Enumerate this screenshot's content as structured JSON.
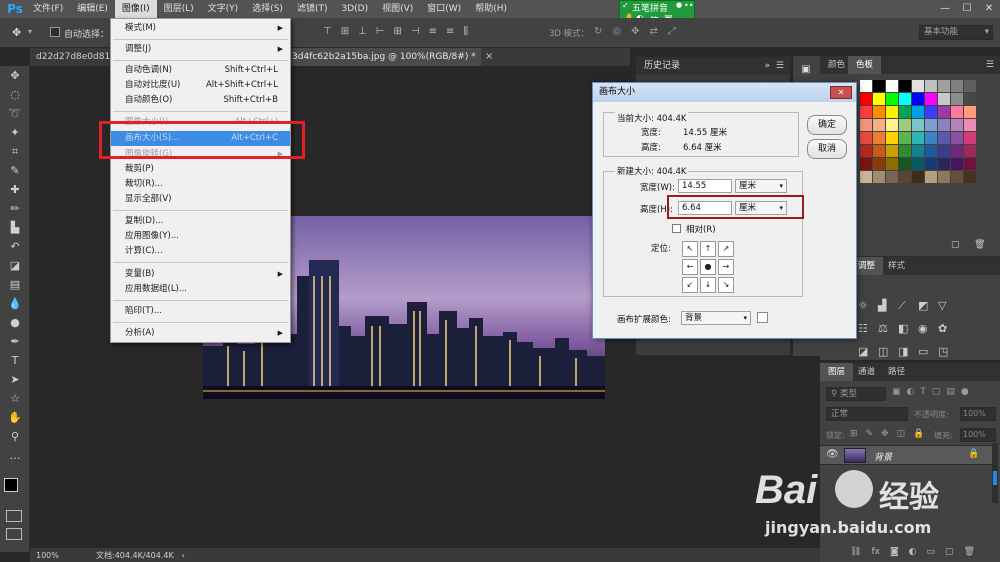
{
  "app": {
    "logo": "Ps"
  },
  "menubar": {
    "items": [
      "文件(F)",
      "编辑(E)",
      "图像(I)",
      "图层(L)",
      "文字(Y)",
      "选择(S)",
      "滤镜(T)",
      "3D(D)",
      "视图(V)",
      "窗口(W)",
      "帮助(H)"
    ],
    "window_controls": [
      "—",
      "☐",
      "✕"
    ]
  },
  "ime": {
    "name": "五笔拼音",
    "icons": [
      "✓",
      "●",
      "••",
      "✋",
      "◐",
      "简",
      "▣"
    ]
  },
  "optbar": {
    "auto_select": "自动选择：",
    "mode_3d": "3D 模式：",
    "workspace": "基本功能"
  },
  "tabs": {
    "tab1": "d22d27d8e0d815",
    "tab2": "3d4fc62b2a15ba.jpg @ 100%(RGB/8#) *",
    "tab2_close": "×"
  },
  "image_menu": {
    "items": [
      {
        "label": "模式(M)",
        "shortcut": "",
        "submenu": true
      },
      {
        "label": "调整(J)",
        "shortcut": "",
        "submenu": true
      },
      {
        "label": "自动色调(N)",
        "shortcut": "Shift+Ctrl+L"
      },
      {
        "label": "自动对比度(U)",
        "shortcut": "Alt+Shift+Ctrl+L"
      },
      {
        "label": "自动颜色(O)",
        "shortcut": "Shift+Ctrl+B"
      },
      {
        "label": "图像大小(I)...",
        "shortcut": "Alt+Ctrl+I"
      },
      {
        "label": "画布大小(S)...",
        "shortcut": "Alt+Ctrl+C"
      },
      {
        "label": "图像旋转(G)",
        "shortcut": "",
        "submenu": true
      },
      {
        "label": "裁剪(P)",
        "shortcut": ""
      },
      {
        "label": "裁切(R)...",
        "shortcut": ""
      },
      {
        "label": "显示全部(V)",
        "shortcut": ""
      },
      {
        "label": "复制(D)...",
        "shortcut": ""
      },
      {
        "label": "应用图像(Y)...",
        "shortcut": ""
      },
      {
        "label": "计算(C)...",
        "shortcut": ""
      },
      {
        "label": "变量(B)",
        "shortcut": "",
        "submenu": true
      },
      {
        "label": "应用数据组(L)...",
        "shortcut": ""
      },
      {
        "label": "陷印(T)...",
        "shortcut": ""
      },
      {
        "label": "分析(A)",
        "shortcut": "",
        "submenu": true
      }
    ]
  },
  "history": {
    "title": "历史记录",
    "menu": "»"
  },
  "dialog": {
    "title": "画布大小",
    "close": "✕",
    "current_size": "当前大小: 404.4K",
    "current_width_label": "宽度:",
    "current_width": "14.55 厘米",
    "current_height_label": "高度:",
    "current_height": "6.64 厘米",
    "new_size": "新建大小: 404.4K",
    "width_label": "宽度(W):",
    "width_value": "14.55",
    "width_unit": "厘米",
    "height_label": "高度(H):",
    "height_value": "6.64",
    "height_unit": "厘米",
    "relative": "相对(R)",
    "anchor_label": "定位:",
    "anchor_arrows": [
      "↖",
      "↑",
      "↗",
      "←",
      "●",
      "→",
      "↙",
      "↓",
      "↘"
    ],
    "ext_color_label": "画布扩展颜色:",
    "ext_color_value": "背景",
    "ok": "确定",
    "cancel": "取消"
  },
  "panels": {
    "color_tab": "颜色",
    "swatches_tab": "色板",
    "adjust_tab": "调整",
    "styles_tab": "样式",
    "layers_tab": "图层",
    "channels_tab": "通道",
    "paths_tab": "路径",
    "kind": "类型",
    "blend_mode": "正常",
    "opacity_label": "不透明度:",
    "opacity_value": "100%",
    "lock_label": "锁定:",
    "fill_label": "填充:",
    "fill_value": "100%",
    "layer_name": "背景"
  },
  "status": {
    "zoom": "100%",
    "doc": "文档:404.4K/404.4K"
  },
  "watermark": {
    "brand": "Bai",
    "brand2": "经验",
    "url": "jingyan.baidu.com"
  }
}
